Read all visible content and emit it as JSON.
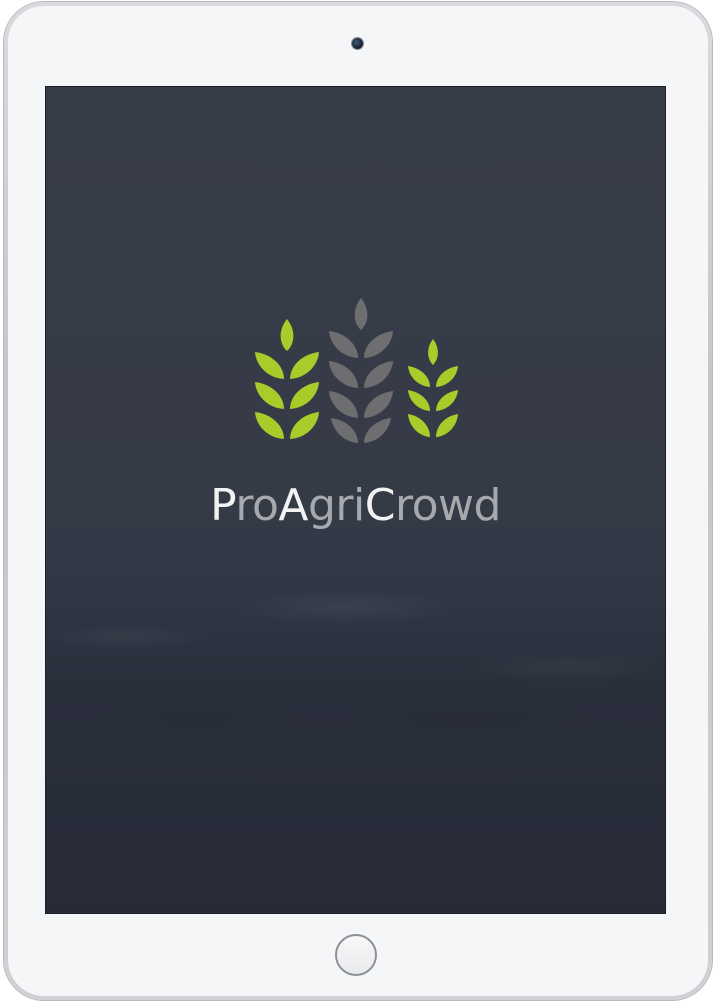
{
  "app": {
    "brand_parts": [
      {
        "text": "P",
        "style": "cap"
      },
      {
        "text": "ro",
        "style": "low"
      },
      {
        "text": "A",
        "style": "cap"
      },
      {
        "text": "gri",
        "style": "low"
      },
      {
        "text": "C",
        "style": "cap"
      },
      {
        "text": "rowd",
        "style": "low"
      }
    ]
  },
  "logo": {
    "icon": "wheat-stalks-icon",
    "colors": {
      "green": "#a9cc2a",
      "gray": "#6e6e70"
    }
  },
  "device": {
    "type": "tablet",
    "frame_color": "#f5f6f8"
  },
  "screen": {
    "background": "#323744"
  }
}
